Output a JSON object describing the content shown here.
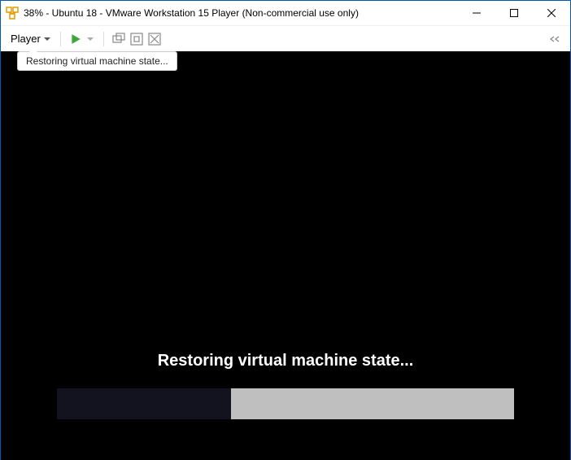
{
  "titlebar": {
    "title": "38% - Ubuntu 18 - VMware Workstation 15 Player (Non-commercial use only)"
  },
  "toolbar": {
    "player_label": "Player",
    "tooltip": "Restoring virtual machine state..."
  },
  "vm": {
    "status_text": "Restoring virtual machine state...",
    "progress_percent": 38
  }
}
